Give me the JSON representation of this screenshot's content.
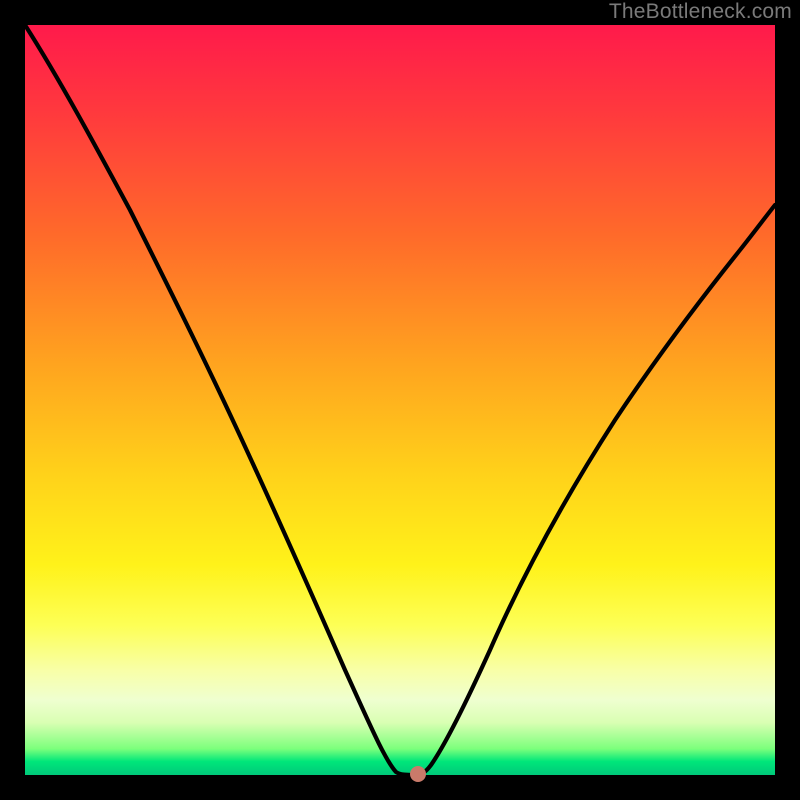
{
  "watermark": "TheBottleneck.com",
  "chart_data": {
    "type": "line",
    "title": "",
    "xlabel": "",
    "ylabel": "",
    "xlim": [
      0,
      100
    ],
    "ylim": [
      0,
      100
    ],
    "grid": false,
    "legend": false,
    "series": [
      {
        "name": "bottleneck-curve",
        "x": [
          0,
          3,
          8,
          14,
          20,
          26,
          32,
          38,
          44,
          47,
          49,
          49.5,
          50,
          50.5,
          51,
          52,
          54,
          58,
          64,
          72,
          80,
          88,
          96,
          100
        ],
        "y": [
          100,
          94,
          85,
          75,
          65,
          55,
          45,
          34,
          20,
          10,
          3,
          0.5,
          0,
          0,
          0,
          0.5,
          4,
          13,
          26,
          40,
          52,
          62,
          71,
          76
        ]
      }
    ],
    "marker": {
      "x": 52,
      "y": 0
    },
    "background_gradient": {
      "top": "#ff1a4b",
      "mid": "#ffd21a",
      "bottom": "#00c97a"
    }
  }
}
